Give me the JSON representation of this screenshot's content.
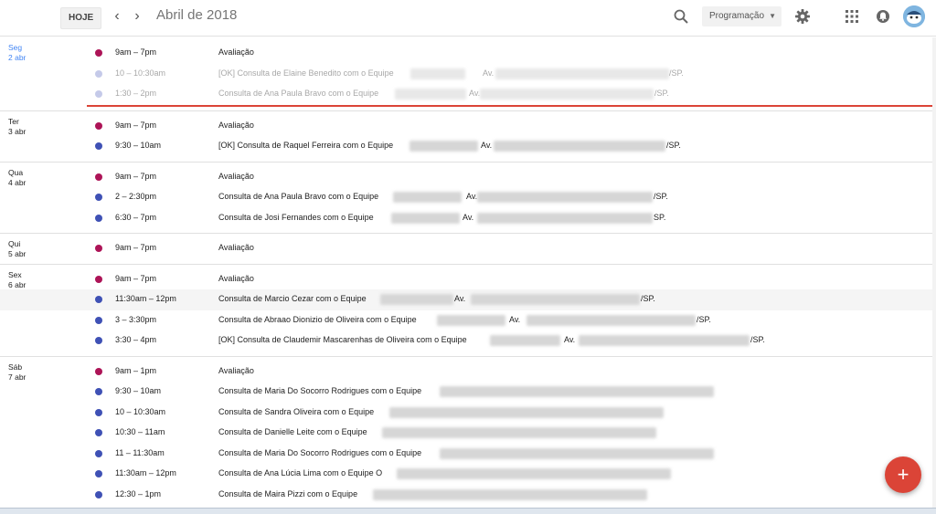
{
  "header": {
    "today_label": "HOJE",
    "prev_icon": "chevron-left-icon",
    "next_icon": "chevron-right-icon",
    "title": "Abril de 2018",
    "view_label": "Programação",
    "colors": {
      "accent": "#4285f4",
      "today_text": "#4285f4",
      "now_line": "#db4437",
      "fab": "#db4437"
    }
  },
  "fab_label": "+",
  "colors": {
    "evaluation": "#ad1457",
    "appointment": "#3f51b5",
    "past": "#c5cae9"
  },
  "days": [
    {
      "weekday": "Seg",
      "date": "2 abr",
      "today": true,
      "events": [
        {
          "time": "9am – 7pm",
          "title": "Avaliação",
          "color": "#ad1457"
        },
        {
          "time": "10 – 10:30am",
          "title": "[OK] Consulta de Elaine Benedito com o Equipe",
          "color": "#c5cae9",
          "past": true,
          "extra": "Av.",
          "suffix": "/SP."
        },
        {
          "time": "1:30 – 2pm",
          "title": "Consulta de Ana Paula Bravo com o Equipe",
          "color": "#c5cae9",
          "past": true,
          "extra": "Av.",
          "suffix": "/SP."
        }
      ]
    },
    {
      "weekday": "Ter",
      "date": "3 abr",
      "events": [
        {
          "time": "9am – 7pm",
          "title": "Avaliação",
          "color": "#ad1457"
        },
        {
          "time": "9:30 – 10am",
          "title": "[OK] Consulta de Raquel Ferreira com o Equipe",
          "color": "#3f51b5",
          "extra": "Av.",
          "suffix": "/SP."
        }
      ]
    },
    {
      "weekday": "Qua",
      "date": "4 abr",
      "events": [
        {
          "time": "9am – 7pm",
          "title": "Avaliação",
          "color": "#ad1457"
        },
        {
          "time": "2 – 2:30pm",
          "title": "Consulta de Ana Paula Bravo com o Equipe",
          "color": "#3f51b5",
          "extra": "Av.",
          "suffix": "/SP."
        },
        {
          "time": "6:30 – 7pm",
          "title": "Consulta de Josi Fernandes com o Equipe",
          "color": "#3f51b5",
          "extra": "Av.",
          "suffix": "SP."
        }
      ]
    },
    {
      "weekday": "Qui",
      "date": "5 abr",
      "events": [
        {
          "time": "9am – 7pm",
          "title": "Avaliação",
          "color": "#ad1457"
        }
      ]
    },
    {
      "weekday": "Sex",
      "date": "6 abr",
      "events": [
        {
          "time": "9am – 7pm",
          "title": "Avaliação",
          "color": "#ad1457"
        },
        {
          "time": "11:30am – 12pm",
          "title": "Consulta de Marcio Cezar com o Equipe",
          "color": "#3f51b5",
          "shade": true,
          "extra": "Av.",
          "suffix": "/SP."
        },
        {
          "time": "3 – 3:30pm",
          "title": "Consulta de Abraao Dionizio de Oliveira com o Equipe",
          "color": "#3f51b5",
          "extra": "Av.",
          "suffix": "/SP."
        },
        {
          "time": "3:30 – 4pm",
          "title": "[OK] Consulta de Claudemir Mascarenhas de Oliveira com o Equipe",
          "color": "#3f51b5",
          "extra": "Av.",
          "suffix": "/SP."
        }
      ]
    },
    {
      "weekday": "Sáb",
      "date": "7 abr",
      "events": [
        {
          "time": "9am – 1pm",
          "title": "Avaliação",
          "color": "#ad1457"
        },
        {
          "time": "9:30 – 10am",
          "title": "Consulta de Maria Do Socorro Rodrigues com o Equipe",
          "color": "#3f51b5"
        },
        {
          "time": "10 – 10:30am",
          "title": "Consulta de Sandra Oliveira com o Equipe",
          "color": "#3f51b5"
        },
        {
          "time": "10:30 – 11am",
          "title": "Consulta de Danielle Leite com o Equipe",
          "color": "#3f51b5"
        },
        {
          "time": "11 – 11:30am",
          "title": "Consulta de Maria Do Socorro Rodrigues com o Equipe",
          "color": "#3f51b5"
        },
        {
          "time": "11:30am – 12pm",
          "title": "Consulta de Ana Lúcia Lima com o Equipe O",
          "color": "#3f51b5"
        },
        {
          "time": "12:30 – 1pm",
          "title": "Consulta de Maira Pizzi com o Equipe",
          "color": "#3f51b5"
        }
      ]
    }
  ]
}
